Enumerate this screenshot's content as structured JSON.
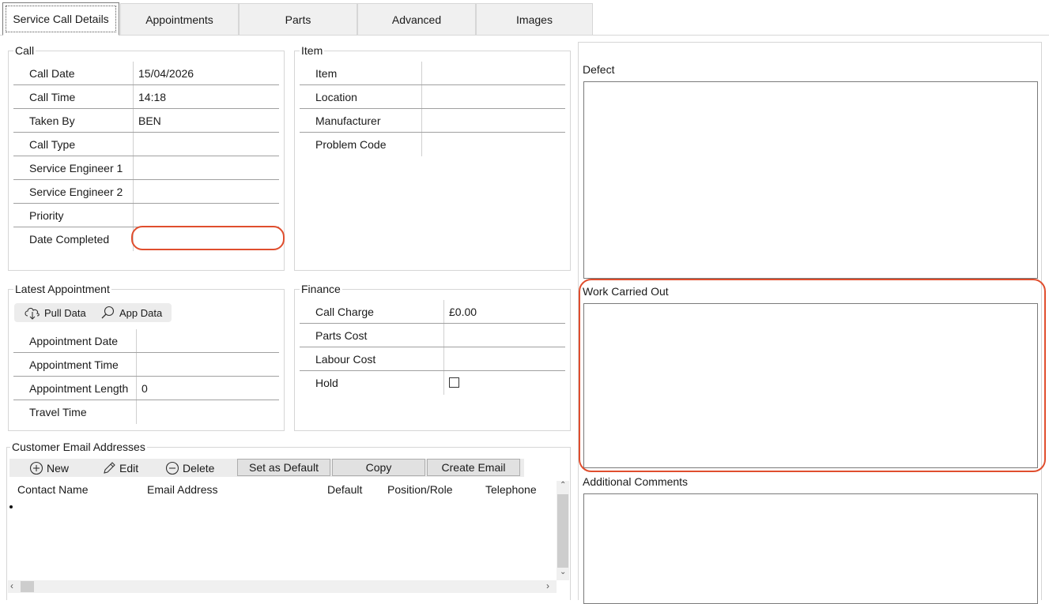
{
  "tabs": [
    {
      "label": "Service Call Details"
    },
    {
      "label": "Appointments"
    },
    {
      "label": "Parts"
    },
    {
      "label": "Advanced"
    },
    {
      "label": "Images"
    }
  ],
  "call": {
    "title": "Call",
    "rows": [
      {
        "label": "Call Date",
        "value": "15/04/2026"
      },
      {
        "label": "Call Time",
        "value": "14:18"
      },
      {
        "label": "Taken By",
        "value": "BEN"
      },
      {
        "label": "Call Type",
        "value": ""
      },
      {
        "label": "Service Engineer 1",
        "value": ""
      },
      {
        "label": "Service Engineer 2",
        "value": ""
      },
      {
        "label": "Priority",
        "value": ""
      },
      {
        "label": "Date Completed",
        "value": ""
      }
    ]
  },
  "item": {
    "title": "Item",
    "rows": [
      {
        "label": "Item",
        "value": ""
      },
      {
        "label": "Location",
        "value": ""
      },
      {
        "label": "Manufacturer",
        "value": ""
      },
      {
        "label": "Problem Code",
        "value": ""
      }
    ]
  },
  "latest": {
    "title": "Latest Appointment",
    "pull_label": "Pull Data",
    "app_label": "App Data",
    "rows": [
      {
        "label": "Appointment Date",
        "value": ""
      },
      {
        "label": "Appointment Time",
        "value": ""
      },
      {
        "label": "Appointment Length",
        "value": "0"
      },
      {
        "label": "Travel Time",
        "value": ""
      }
    ]
  },
  "finance": {
    "title": "Finance",
    "rows": [
      {
        "label": "Call Charge",
        "value": "£0.00"
      },
      {
        "label": "Parts Cost",
        "value": ""
      },
      {
        "label": "Labour Cost",
        "value": ""
      },
      {
        "label": "Hold",
        "value": ""
      }
    ],
    "hold_checked": false
  },
  "emails": {
    "title": "Customer Email Addresses",
    "new_label": "New",
    "edit_label": "Edit",
    "delete_label": "Delete",
    "set_default_label": "Set as Default",
    "copy_label": "Copy",
    "create_email_label": "Create Email",
    "columns": [
      "Contact Name",
      "Email Address",
      "Default",
      "Position/Role",
      "Telephone"
    ]
  },
  "right": {
    "defect_label": "Defect",
    "work_label": "Work Carried Out",
    "comments_label": "Additional Comments"
  },
  "colors": {
    "highlight": "#e04e2e"
  }
}
